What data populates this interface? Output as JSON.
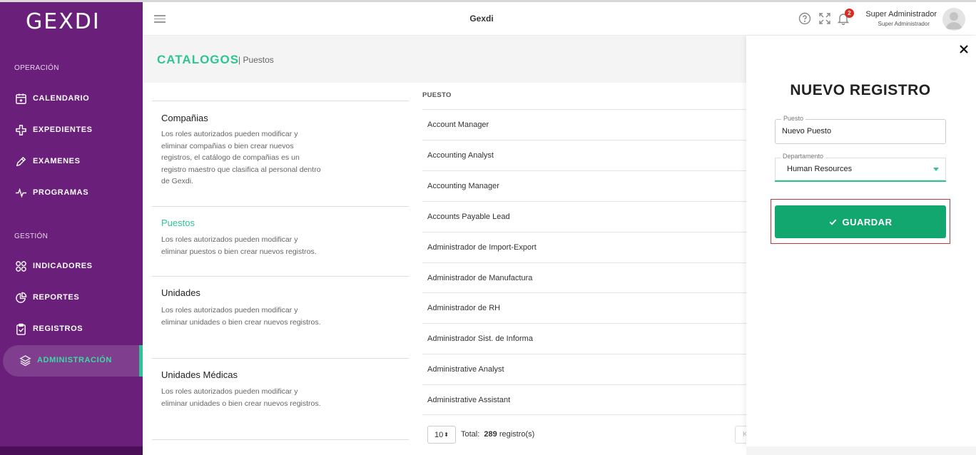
{
  "app": {
    "logo": "GEXDI",
    "title": "Gexdi"
  },
  "header": {
    "notifications_count": "2",
    "user_name": "Super Administrador",
    "user_role": "Super Administrador"
  },
  "sidebar": {
    "sections": [
      {
        "label": "OPERACIÓN",
        "items": [
          {
            "label": "CALENDARIO",
            "icon": "calendar-icon"
          },
          {
            "label": "EXPEDIENTES",
            "icon": "medical-cross-icon"
          },
          {
            "label": "EXAMENES",
            "icon": "pencil-icon"
          },
          {
            "label": "PROGRAMAS",
            "icon": "pulse-icon"
          }
        ]
      },
      {
        "label": "GESTIÓN",
        "items": [
          {
            "label": "INDICADORES",
            "icon": "grid-icon"
          },
          {
            "label": "REPORTES",
            "icon": "pie-chart-icon"
          },
          {
            "label": "REGISTROS",
            "icon": "clipboard-icon"
          },
          {
            "label": "ADMINISTRACIÓN",
            "icon": "layers-icon",
            "active": true
          }
        ]
      }
    ]
  },
  "page": {
    "title": "CATALOGOS",
    "subtitle": "| Puestos"
  },
  "catalogs": [
    {
      "title": "Compañias",
      "desc": "Los roles autorizados pueden modificar y eliminar compañias o bien crear nuevos registros, el catálogo de compañias es un registro maestro que clasifica al personal dentro de Gexdi."
    },
    {
      "title": "Puestos",
      "desc": "Los roles autorizados pueden modificar y eliminar puestos o bien crear nuevos registros.",
      "active": true
    },
    {
      "title": "Unidades",
      "desc": "Los roles autorizados pueden modificar y eliminar unidades o bien crear nuevos registros."
    },
    {
      "title": "Unidades Médicas",
      "desc": "Los roles autorizados pueden modificar y eliminar unidades o bien crear nuevos registros."
    }
  ],
  "table": {
    "header": "PUESTO",
    "rows": [
      "Account Manager",
      "Accounting Analyst",
      "Accounting Manager",
      "Accounts Payable Lead",
      "Administrador de Import-Export",
      "Administrador de Manufactura",
      "Administrador de RH",
      "Administrador Sist. de Informa",
      "Administrative Analyst",
      "Administrative Assistant"
    ],
    "page_size": "10",
    "total_label": "Total:",
    "total_count": "289",
    "total_suffix": "registro(s)",
    "prev_label": "K"
  },
  "panel": {
    "title": "NUEVO REGISTRO",
    "puesto_label": "Puesto",
    "puesto_value": "Nuevo Puesto",
    "departamento_label": "Departamento",
    "departamento_value": "Human Resources",
    "save_label": "GUARDAR"
  },
  "colors": {
    "sidebar": "#6a1f7a",
    "accent": "#2ec493",
    "save_button": "#11a76f",
    "badge": "#d62d20"
  }
}
